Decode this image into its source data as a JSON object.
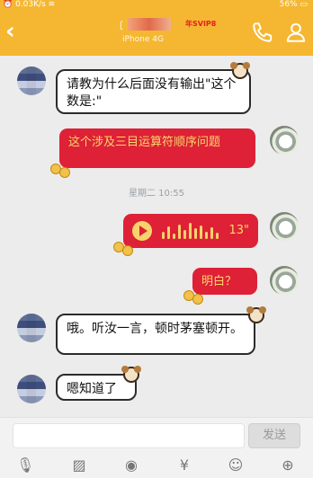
{
  "status": {
    "speed": "0.03K/s",
    "battery": "56%"
  },
  "header": {
    "back_icon": "chevron-left-icon",
    "contact_sub": "iPhone",
    "network": "4G",
    "vip_badge": "年SVIP8",
    "phone_icon": "phone-icon",
    "profile_icon": "person-icon"
  },
  "messages": [
    {
      "side": "left",
      "style": "white",
      "text": "请教为什么后面没有输出\"这个数是:\""
    },
    {
      "side": "right",
      "style": "red",
      "text": "这个涉及三目运算符顺序问题"
    },
    {
      "timestamp": "星期二 10:55"
    },
    {
      "side": "right",
      "style": "red",
      "voice_duration": "13\""
    },
    {
      "side": "right",
      "style": "red",
      "text": "明白？"
    },
    {
      "side": "left",
      "style": "white",
      "text": "哦。听汝一言，顿时茅塞顿开。"
    },
    {
      "side": "left",
      "style": "white",
      "text": "嗯知道了"
    }
  ],
  "input": {
    "send_label": "发送"
  },
  "toolbar": [
    "microphone-icon",
    "image-icon",
    "camera-icon",
    "red-packet-icon",
    "emoji-icon",
    "plus-icon"
  ],
  "colors": {
    "header": "#f5b731",
    "bubble_red": "#de2136",
    "bubble_text": "#f6d86b"
  }
}
